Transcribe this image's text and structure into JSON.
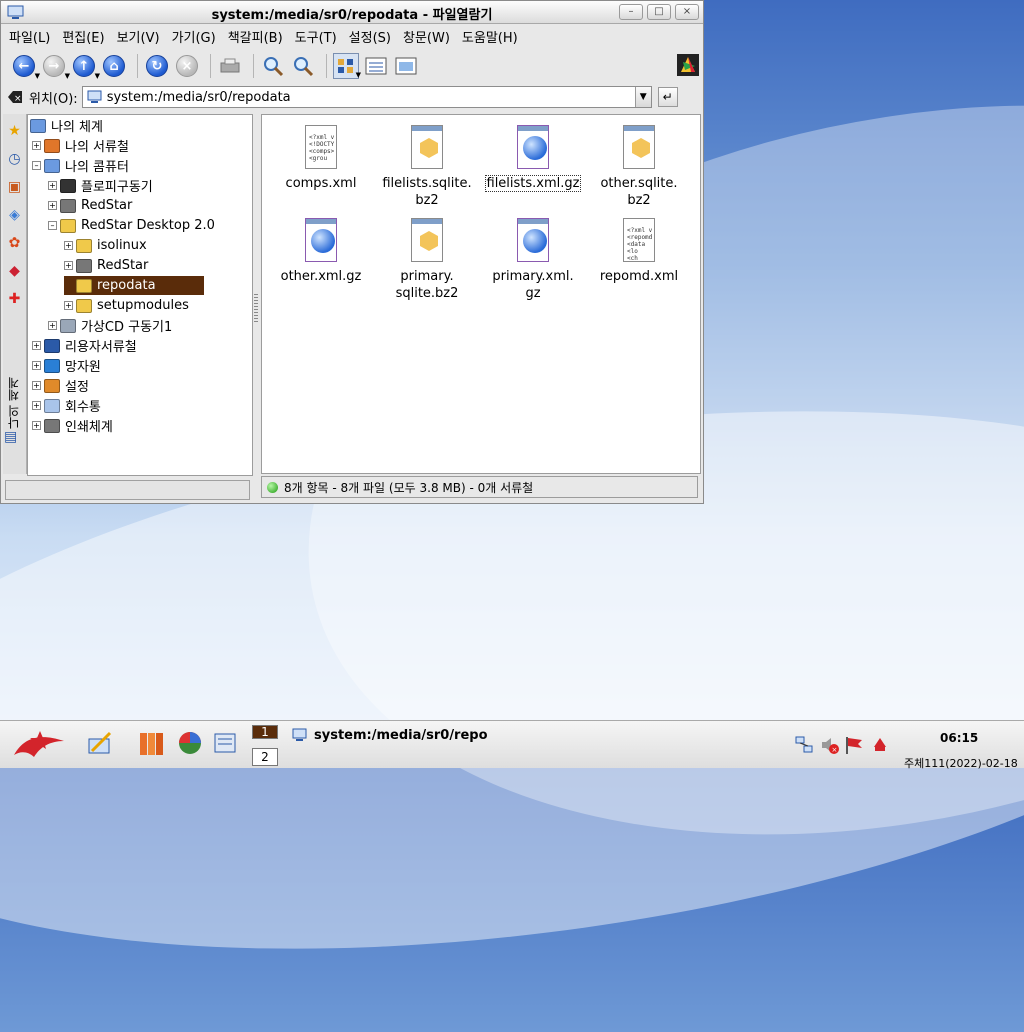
{
  "window": {
    "title": "system:/media/sr0/repodata - 파일열람기",
    "buttons": {
      "minimize": "–",
      "maximize": "□",
      "close": "×"
    }
  },
  "menu": [
    "파일(L)",
    "편집(E)",
    "보기(V)",
    "가기(G)",
    "책갈피(B)",
    "도구(T)",
    "설정(S)",
    "창문(W)",
    "도움말(H)"
  ],
  "location": {
    "label": "위치(O):",
    "value": "system:/media/sr0/repodata"
  },
  "sidebar": {
    "vertical_label": "나의 체계"
  },
  "tree": {
    "items": [
      {
        "label": "나의 체계",
        "level": 0,
        "expander": ""
      },
      {
        "label": "나의 서류철",
        "level": 1,
        "expander": "+"
      },
      {
        "label": "나의 콤퓨터",
        "level": 1,
        "expander": "–"
      },
      {
        "label": "플로피구동기",
        "level": 2,
        "expander": "+"
      },
      {
        "label": "RedStar",
        "level": 2,
        "expander": "+"
      },
      {
        "label": "RedStar Desktop 2.0",
        "level": 2,
        "expander": "–"
      },
      {
        "label": "isolinux",
        "level": 3,
        "expander": "+"
      },
      {
        "label": "RedStar",
        "level": 3,
        "expander": "+"
      },
      {
        "label": "repodata",
        "level": 3,
        "expander": ""
      },
      {
        "label": "setupmodules",
        "level": 3,
        "expander": "+"
      },
      {
        "label": "가상CD 구동기1",
        "level": 2,
        "expander": "+"
      },
      {
        "label": "리용자서류철",
        "level": 1,
        "expander": "+"
      },
      {
        "label": "망자원",
        "level": 1,
        "expander": "+"
      },
      {
        "label": "설정",
        "level": 1,
        "expander": "+"
      },
      {
        "label": "회수통",
        "level": 1,
        "expander": "+"
      },
      {
        "label": "인쇄체계",
        "level": 1,
        "expander": "+"
      }
    ]
  },
  "files": [
    {
      "name_lines": [
        "comps.xml"
      ],
      "kind": "xml-text",
      "code": [
        "<?xml v",
        "<!DOCTY",
        "<comps>",
        " <grou"
      ]
    },
    {
      "name_lines": [
        "filelists.sqlite.",
        "bz2"
      ],
      "kind": "archive"
    },
    {
      "name_lines": [
        "filelists.xml.gz"
      ],
      "kind": "globe",
      "selected": true
    },
    {
      "name_lines": [
        "other.sqlite.",
        "bz2"
      ],
      "kind": "archive"
    },
    {
      "name_lines": [
        "other.xml.gz"
      ],
      "kind": "globe"
    },
    {
      "name_lines": [
        "primary.",
        "sqlite.bz2"
      ],
      "kind": "archive"
    },
    {
      "name_lines": [
        "primary.xml.",
        "gz"
      ],
      "kind": "globe"
    },
    {
      "name_lines": [
        "repomd.xml"
      ],
      "kind": "xml-text",
      "code": [
        "<?xml v",
        "<repomd",
        " <data",
        "  <lo",
        "  <ch"
      ]
    }
  ],
  "status": {
    "text": "8개 항목 - 8개 파일 (모두 3.8 MB) - 0개 서류철"
  },
  "taskbar": {
    "desktops": [
      "1",
      "2"
    ],
    "task_title": "system:/media/sr0/repo",
    "clock": "06:15",
    "date": "주체111(2022)-02-18"
  },
  "colors": {
    "selection": "#5a2c0a",
    "accent": "#1f5bd1",
    "folder": "#f3c45a"
  }
}
